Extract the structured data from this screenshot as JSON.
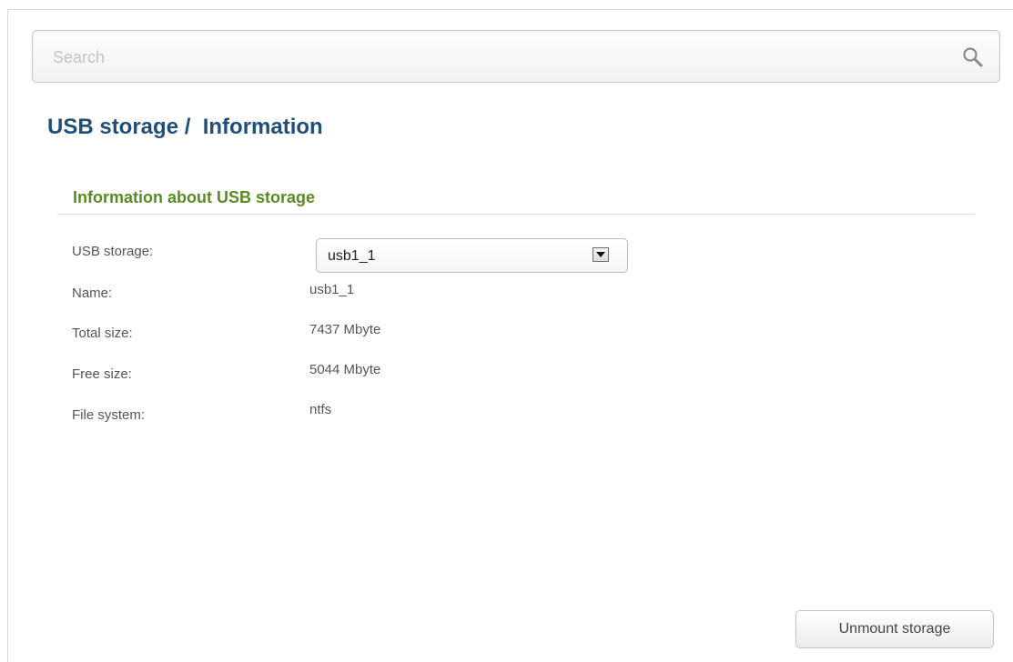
{
  "search": {
    "placeholder": "Search",
    "icon": "search-icon"
  },
  "page": {
    "title": "USB storage /  Information"
  },
  "section": {
    "title": "Information about USB storage"
  },
  "fields": {
    "usb_storage": {
      "label": "USB storage:",
      "value": "usb1_1"
    },
    "name": {
      "label": "Name:",
      "value": "usb1_1"
    },
    "total_size": {
      "label": "Total size:",
      "value": "7437 Mbyte"
    },
    "free_size": {
      "label": "Free size:",
      "value": "5044 Mbyte"
    },
    "file_system": {
      "label": "File system:",
      "value": "ntfs"
    }
  },
  "actions": {
    "unmount_label": "Unmount storage"
  },
  "colors": {
    "title": "#1f4f79",
    "section_title": "#5a8a23",
    "text": "#555555"
  }
}
